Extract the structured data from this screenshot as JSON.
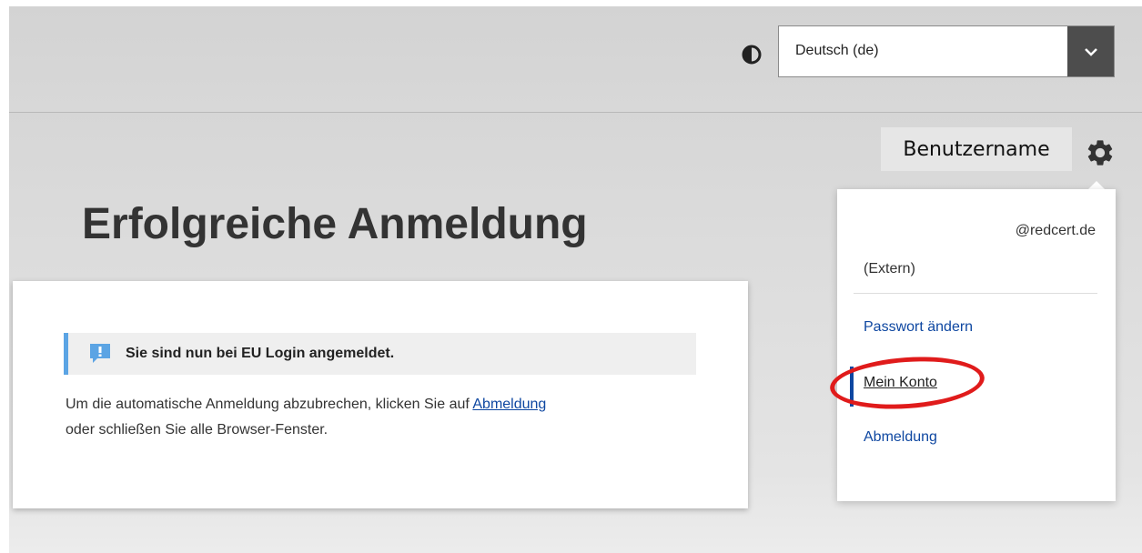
{
  "header": {
    "language_value": "Deutsch (de)"
  },
  "user": {
    "label": "Benutzername",
    "email": "@redcert.de",
    "type": "(Extern)"
  },
  "main": {
    "title": "Erfolgreiche Anmeldung",
    "notice": "Sie sind nun bei EU Login angemeldet.",
    "body_pre": "Um die automatische Anmeldung abzubrechen, klicken Sie auf ",
    "body_link": "Abmeldung",
    "body_post": "oder schließen Sie alle Browser-Fenster."
  },
  "menu": {
    "items": [
      {
        "label": "Passwort ändern"
      },
      {
        "label": "Mein Konto",
        "active": true
      },
      {
        "label": "Abmeldung"
      }
    ]
  },
  "colors": {
    "link": "#0e47a1",
    "notice_accent": "#5ba4e4",
    "highlight": "#e01b1b"
  },
  "icons": [
    "contrast-icon",
    "chevron-down-icon",
    "gear-icon",
    "info-icon"
  ]
}
